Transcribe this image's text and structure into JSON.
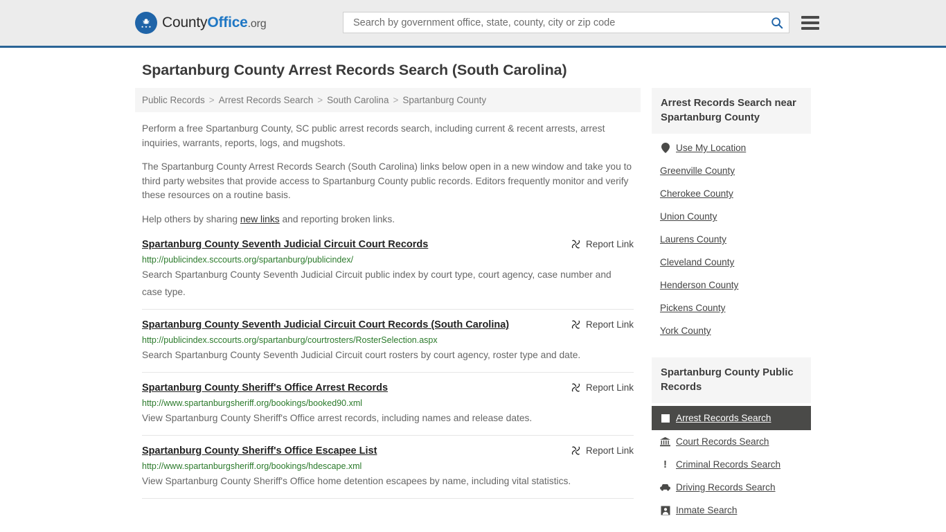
{
  "header": {
    "logo": {
      "part1": "County",
      "part2": "Office",
      "part3": ".org",
      "icon": "eagle-seal-icon"
    },
    "search": {
      "placeholder": "Search by government office, state, county, city or zip code",
      "value": "",
      "icon": "search-icon"
    },
    "menu_icon": "hamburger-menu-icon",
    "accent_color": "#2a6496",
    "background": "#ececec"
  },
  "page_title": "Spartanburg County Arrest Records Search (South Carolina)",
  "breadcrumb": {
    "separator": ">",
    "items": [
      "Public Records",
      "Arrest Records Search",
      "South Carolina",
      "Spartanburg County"
    ]
  },
  "intro": {
    "p1": "Perform a free Spartanburg County, SC public arrest records search, including current & recent arrests, arrest inquiries, warrants, reports, logs, and mugshots.",
    "p2": "The Spartanburg County Arrest Records Search (South Carolina) links below open in a new window and take you to third party websites that provide access to Spartanburg County public records. Editors frequently monitor and verify these resources on a routine basis.",
    "p3_before": "Help others by sharing ",
    "p3_link": "new links",
    "p3_after": " and reporting broken links."
  },
  "results": {
    "report_label": "Report Link",
    "report_icon": "broken-link-icon",
    "items": [
      {
        "title": "Spartanburg County Seventh Judicial Circuit Court Records",
        "url": "http://publicindex.sccourts.org/spartanburg/publicindex/",
        "description": "Search Spartanburg County Seventh Judicial Circuit public index by court type, court agency, case number and case type."
      },
      {
        "title": "Spartanburg County Seventh Judicial Circuit Court Records (South Carolina)",
        "url": "http://publicindex.sccourts.org/spartanburg/courtrosters/RosterSelection.aspx",
        "description": "Search Spartanburg County Seventh Judicial Circuit court rosters by court agency, roster type and date."
      },
      {
        "title": "Spartanburg County Sheriff's Office Arrest Records",
        "url": "http://www.spartanburgsheriff.org/bookings/booked90.xml",
        "description": "View Spartanburg County Sheriff's Office arrest records, including names and release dates."
      },
      {
        "title": "Spartanburg County Sheriff's Office Escapee List",
        "url": "http://www.spartanburgsheriff.org/bookings/hdescape.xml",
        "description": "View Spartanburg County Sheriff's Office home detention escapees by name, including vital statistics."
      }
    ]
  },
  "sidebar": {
    "nearby": {
      "heading": "Arrest Records Search near Spartanburg County",
      "items": [
        {
          "label": "Use My Location",
          "icon": "map-pin-icon"
        },
        {
          "label": "Greenville County",
          "icon": ""
        },
        {
          "label": "Cherokee County",
          "icon": ""
        },
        {
          "label": "Union County",
          "icon": ""
        },
        {
          "label": "Laurens County",
          "icon": ""
        },
        {
          "label": "Cleveland County",
          "icon": ""
        },
        {
          "label": "Henderson County",
          "icon": ""
        },
        {
          "label": "Pickens County",
          "icon": ""
        },
        {
          "label": "York County",
          "icon": ""
        }
      ]
    },
    "public_records": {
      "heading": "Spartanburg County Public Records",
      "items": [
        {
          "label": "Arrest Records Search",
          "icon": "white-square-icon",
          "active": true
        },
        {
          "label": "Court Records Search",
          "icon": "courthouse-icon",
          "active": false
        },
        {
          "label": "Criminal Records Search",
          "icon": "exclamation-icon",
          "active": false
        },
        {
          "label": "Driving Records Search",
          "icon": "car-icon",
          "active": false
        },
        {
          "label": "Inmate Search",
          "icon": "inmate-icon",
          "active": false
        }
      ]
    }
  }
}
